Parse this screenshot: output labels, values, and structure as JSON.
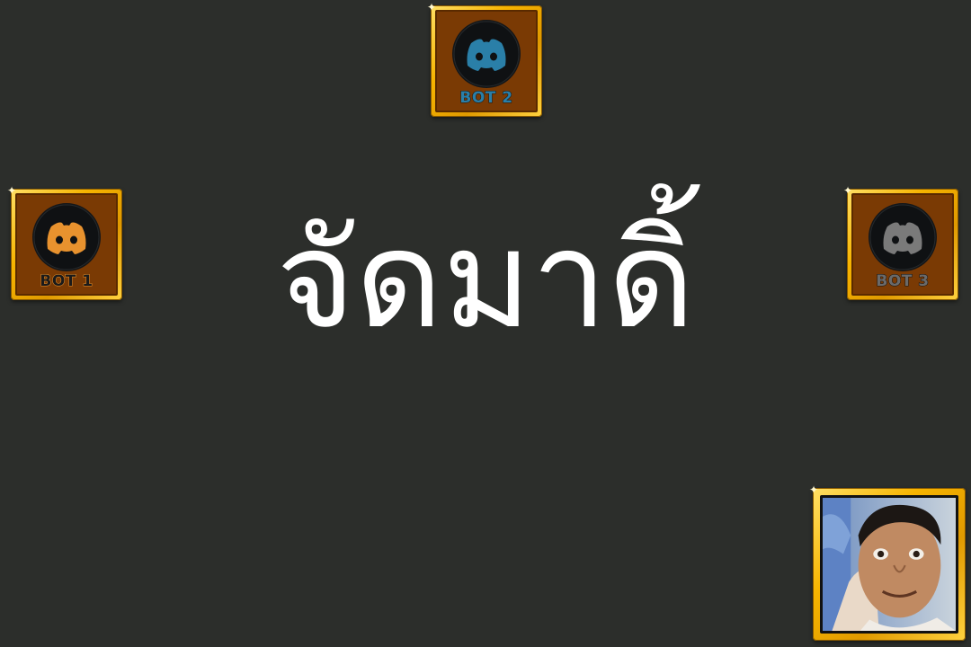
{
  "center_text": "จัดมาดิ้",
  "bots": [
    {
      "label": "BOT 1",
      "icon": "discord-icon",
      "icon_color": "#e8922e",
      "label_color": "#1a1a1a"
    },
    {
      "label": "BOT 2",
      "icon": "discord-icon",
      "icon_color": "#2a7fa8",
      "label_color": "#2a7fa8"
    },
    {
      "label": "BOT 3",
      "icon": "discord-icon",
      "icon_color": "#7a7a7a",
      "label_color": "#6a6a6a"
    }
  ],
  "player": {
    "avatar": "player-photo"
  },
  "colors": {
    "background": "#2c2e2b",
    "frame_gold": "#f6b400",
    "slot_fill": "#7a3a04"
  }
}
